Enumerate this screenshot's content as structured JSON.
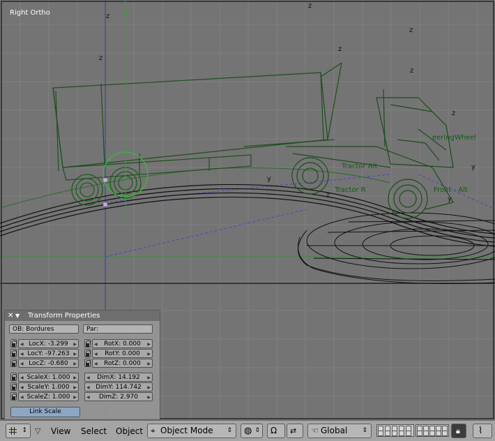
{
  "viewport": {
    "view_name": "Right Ortho",
    "labels": {
      "steering_wheel": "eeringWheel",
      "tractor_ait": "Tractor Ait",
      "tractor_r": "Tractor R",
      "front_alt": "Front - Alt",
      "y_axis": "y",
      "z_axis": "z"
    }
  },
  "transform_panel": {
    "title": "Transform Properties",
    "ob_label": "OB: Bordures",
    "par_label": "Par:",
    "loc": [
      "LocX: -3.299",
      "LocY: -97.263",
      "LocZ: -0.680"
    ],
    "rot": [
      "RotX: 0.000",
      "RotY: 0.000",
      "RotZ: 0.000"
    ],
    "scale": [
      "ScaleX: 1.000",
      "ScaleY: 1.000",
      "ScaleZ: 1.000"
    ],
    "dim": [
      "DimX: 14.192",
      "DimY: 114.742",
      "DimZ: 2.970"
    ],
    "link_scale": "Link Scale"
  },
  "header": {
    "menus": [
      "View",
      "Select",
      "Object"
    ],
    "mode": "Object Mode",
    "orientation": "Global"
  }
}
